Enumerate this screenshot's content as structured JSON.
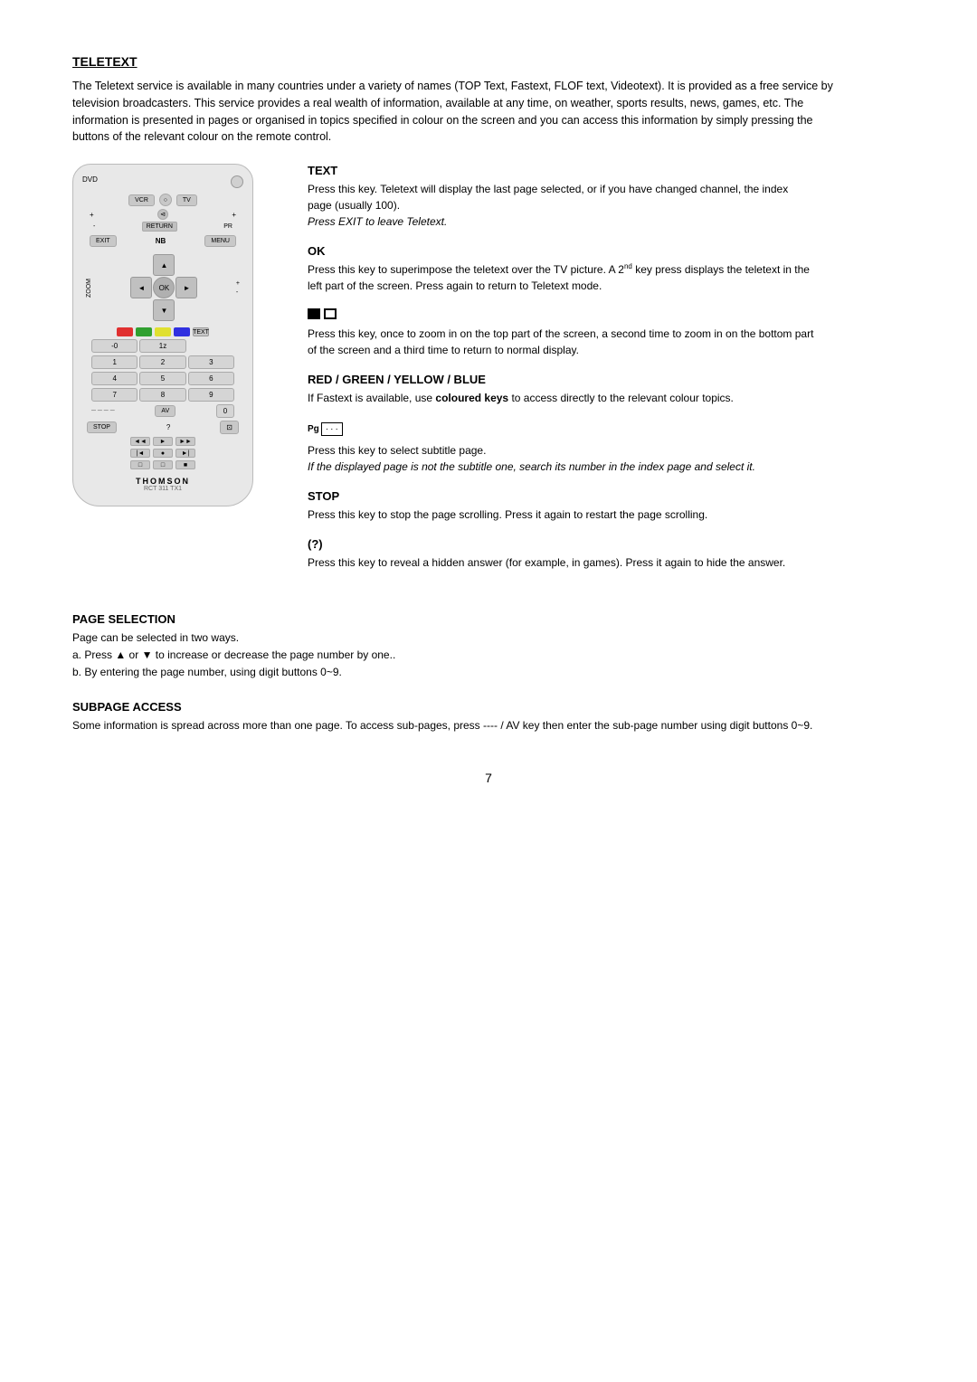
{
  "page": {
    "title": "TELETEXT",
    "intro": "The Teletext service is available in many countries under a variety of names (TOP Text, Fastext, FLOF text, Videotext). It is provided as a free service by television broadcasters. This service provides a real wealth of information, available at any time, on weather, sports results, news, games, etc. The information is presented in pages or organised in topics specified in colour on the screen and you can access this information by simply pressing the buttons of the relevant colour on the remote control.",
    "page_number": "7"
  },
  "remote": {
    "brand": "THOMSON",
    "model": "RCT 311 TX1",
    "labels": {
      "dvd": "DVD",
      "vcr": "VCR",
      "tv": "TV",
      "exit": "EXIT",
      "menu": "MENU",
      "zoom": "ZOOM",
      "return": "RETURN",
      "ok": "OK",
      "nb": "NB",
      "av": "AV",
      "stop": "STOP",
      "text": "TEXT",
      "pr": "PR"
    }
  },
  "sections": {
    "text": {
      "title": "TEXT",
      "body": "Press this key. Teletext will display the last page selected, or if you have changed channel, the index page (usually 100).",
      "italic": "Press EXIT to leave Teletext."
    },
    "ok": {
      "title": "OK",
      "body_part1": "Press this key to superimpose the teletext over the TV picture. A 2",
      "superscript": "nd",
      "body_part2": " key press displays the teletext in the left part of the screen. Press again to return to Teletext mode."
    },
    "zoom": {
      "title": "◼  ◼",
      "body": "Press this key, once to zoom in on the top part of the screen, a second time to zoom in on the bottom part of the screen and a third time to return to normal display."
    },
    "colors": {
      "title": "RED / GREEN / YELLOW / BLUE",
      "body_start": "If Fastext is available, use ",
      "bold": "coloured keys",
      "body_end": " to access directly to the relevant colour topics."
    },
    "subtitle": {
      "title_prefix": "Pg",
      "body": "Press this key to select subtitle page.",
      "italic": "If the displayed page is not the subtitle one, search its number in the index page and select it."
    },
    "stop": {
      "title": "STOP",
      "body": "Press this key to stop the page scrolling. Press it again to restart the page scrolling."
    },
    "question": {
      "title": "(?)",
      "body": "Press this key to reveal a hidden answer (for example, in games). Press it again to hide the answer."
    }
  },
  "page_selection": {
    "title": "PAGE SELECTION",
    "line1": "Page can be selected in two ways.",
    "line2": "a. Press ▲ or ▼ to increase or decrease the page number by one..",
    "line3": "b. By entering the page number, using digit buttons 0~9."
  },
  "subpage_access": {
    "title": "SUBPAGE ACCESS",
    "body": "Some information is spread across more than one page. To access sub-pages, press ---- / AV key then enter the sub-page number using digit buttons 0~9."
  }
}
